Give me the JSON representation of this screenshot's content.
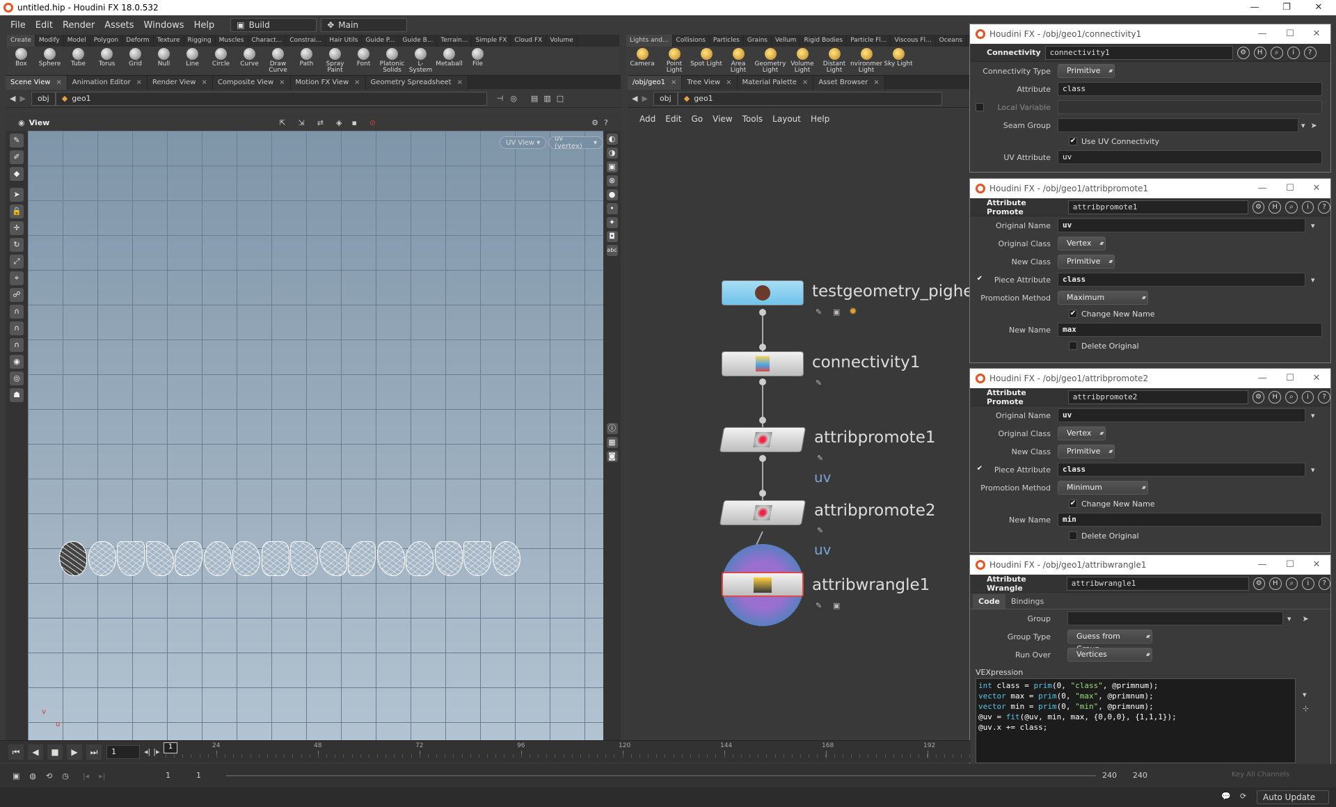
{
  "window": {
    "title": "untitled.hip - Houdini FX 18.0.532"
  },
  "menu": {
    "items": [
      "File",
      "Edit",
      "Render",
      "Assets",
      "Windows",
      "Help"
    ],
    "desktop": "Build",
    "context": "Main"
  },
  "shelf_left": {
    "tabs": [
      "Create",
      "Modify",
      "Model",
      "Polygon",
      "Deform",
      "Texture",
      "Rigging",
      "Muscles",
      "Charact...",
      "Constrai...",
      "Hair Utils",
      "Guide P...",
      "Guide B...",
      "Terrain...",
      "Simple FX",
      "Cloud FX",
      "Volume"
    ],
    "tools": [
      "Box",
      "Sphere",
      "Tube",
      "Torus",
      "Grid",
      "Null",
      "Line",
      "Circle",
      "Curve",
      "Draw Curve",
      "Path",
      "Spray Paint",
      "Font",
      "Platonic Solids",
      "L-System",
      "Metaball",
      "File"
    ]
  },
  "shelf_right": {
    "tabs": [
      "Lights and...",
      "Collisions",
      "Particles",
      "Grains",
      "Vellum",
      "Rigid Bodies",
      "Particle Fl...",
      "Viscous Fl...",
      "Oceans"
    ],
    "tools": [
      "Camera",
      "Point Light",
      "Spot Light",
      "Area Light",
      "Geometry Light",
      "Volume Light",
      "Distant Light",
      "Environment Light",
      "Sky Light"
    ]
  },
  "left_pane": {
    "tabs": [
      "Scene View",
      "Animation Editor",
      "Render View",
      "Composite View",
      "Motion FX View",
      "Geometry Spreadsheet"
    ],
    "path": [
      "obj",
      "geo1"
    ],
    "view_label": "View",
    "uv_view": "UV View",
    "uv_attr": "uv (vertex)",
    "axis_v": "v",
    "axis_u": "u"
  },
  "right_pane": {
    "tabs": [
      "/obj/geo1",
      "Tree View",
      "Material Palette",
      "Asset Browser"
    ],
    "path": [
      "obj",
      "geo1"
    ],
    "menu": [
      "Add",
      "Edit",
      "Go",
      "View",
      "Tools",
      "Layout",
      "Help"
    ],
    "nodes": [
      "testgeometry_pighea",
      "connectivity1",
      "attribpromote1",
      "attribpromote2",
      "attribwrangle1"
    ],
    "uv_label": "uv"
  },
  "connectivity": {
    "title": "Houdini FX - /obj/geo1/connectivity1",
    "type": "Connectivity",
    "name": "connectivity1",
    "labels": {
      "ctype": "Connectivity Type",
      "attr": "Attribute",
      "local": "Local Variable",
      "seam": "Seam Group",
      "uvconn": "Use UV Connectivity",
      "uvattr": "UV Attribute"
    },
    "values": {
      "ctype": "Primitive",
      "attr": "class",
      "local": "",
      "seam": "",
      "uvattr": "uv"
    }
  },
  "promote1": {
    "title": "Houdini FX - /obj/geo1/attribpromote1",
    "type": "Attribute Promote",
    "name": "attribpromote1",
    "labels": {
      "orig": "Original Name",
      "oclass": "Original Class",
      "nclass": "New Class",
      "piece": "Piece Attribute",
      "method": "Promotion Method",
      "change": "Change New Name",
      "newname": "New Name",
      "del": "Delete Original"
    },
    "values": {
      "orig": "uv",
      "oclass": "Vertex",
      "nclass": "Primitive",
      "piece": "class",
      "method": "Maximum",
      "newname": "max"
    }
  },
  "promote2": {
    "title": "Houdini FX - /obj/geo1/attribpromote2",
    "type": "Attribute Promote",
    "name": "attribpromote2",
    "labels": {
      "orig": "Original Name",
      "oclass": "Original Class",
      "nclass": "New Class",
      "piece": "Piece Attribute",
      "method": "Promotion Method",
      "change": "Change New Name",
      "newname": "New Name",
      "del": "Delete Original"
    },
    "values": {
      "orig": "uv",
      "oclass": "Vertex",
      "nclass": "Primitive",
      "piece": "class",
      "method": "Minimum",
      "newname": "min"
    }
  },
  "wrangle": {
    "title": "Houdini FX - /obj/geo1/attribwrangle1",
    "type": "Attribute Wrangle",
    "name": "attribwrangle1",
    "tabs": [
      "Code",
      "Bindings"
    ],
    "labels": {
      "group": "Group",
      "gtype": "Group Type",
      "runover": "Run Over",
      "vex": "VEXpression"
    },
    "values": {
      "group": "",
      "gtype": "Guess from Group",
      "runover": "Vertices"
    }
  },
  "timeline": {
    "frame": "1",
    "ticks": [
      "24",
      "48",
      "72",
      "96",
      "120",
      "144",
      "168",
      "192"
    ],
    "current": "1"
  },
  "bottom": {
    "start": "1",
    "start2": "1",
    "end": "240",
    "end2": "240",
    "keys": "Key All Channels"
  },
  "status": {
    "update": "Auto Update"
  }
}
